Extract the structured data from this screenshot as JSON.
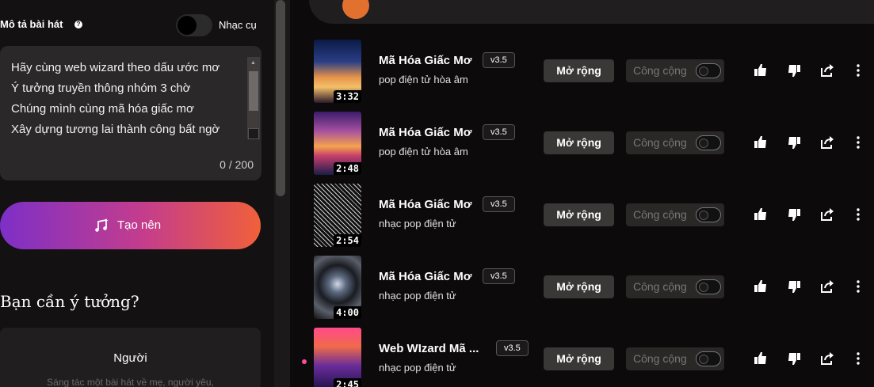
{
  "left": {
    "desc_label": "Mô tả bài hát",
    "instrumental_label": "Nhạc cụ",
    "lyrics": "Hãy cùng web wizard theo dấu ước mơ\nÝ tưởng truyền thông nhóm 3 chờ\nChúng mình cùng mã hóa giấc mơ\nXây dựng tương lai thành công bất ngờ",
    "counter": "0 / 200",
    "create_label": "Tạo nên",
    "ideas_heading": "Bạn cần ý tưởng?",
    "idea_card": {
      "title": "Người",
      "subtitle": "Sáng tác một bài hát về mẹ, người yêu,"
    }
  },
  "songs": [
    {
      "title": "Mã Hóa Giấc Mơ",
      "version": "v3.5",
      "genre": "pop điện tử hòa âm",
      "duration": "3:32",
      "extend": "Mở rộng",
      "public": "Công cộng"
    },
    {
      "title": "Mã Hóa Giấc Mơ",
      "version": "v3.5",
      "genre": "pop điện tử hòa âm",
      "duration": "2:48",
      "extend": "Mở rộng",
      "public": "Công cộng"
    },
    {
      "title": "Mã Hóa Giấc Mơ",
      "version": "v3.5",
      "genre": "nhạc pop điện tử",
      "duration": "2:54",
      "extend": "Mở rộng",
      "public": "Công cộng"
    },
    {
      "title": "Mã Hóa Giấc Mơ",
      "version": "v3.5",
      "genre": "nhạc pop điện tử",
      "duration": "4:00",
      "extend": "Mở rộng",
      "public": "Công cộng"
    },
    {
      "title": "Web WIzard Mã ...",
      "version": "v3.5",
      "genre": "nhạc pop điện tử",
      "duration": "2:45",
      "extend": "Mở rộng",
      "public": "Công cộng"
    }
  ],
  "colors": {
    "accent_gradient": [
      "#7d2fc7",
      "#c43d8c",
      "#f0603a"
    ],
    "new_dot": "#ff4aa0",
    "background": "#0c0a0a"
  },
  "icons": [
    "help-icon",
    "music-note-icon",
    "thumbs-up-icon",
    "thumbs-down-icon",
    "share-icon",
    "more-icon"
  ]
}
